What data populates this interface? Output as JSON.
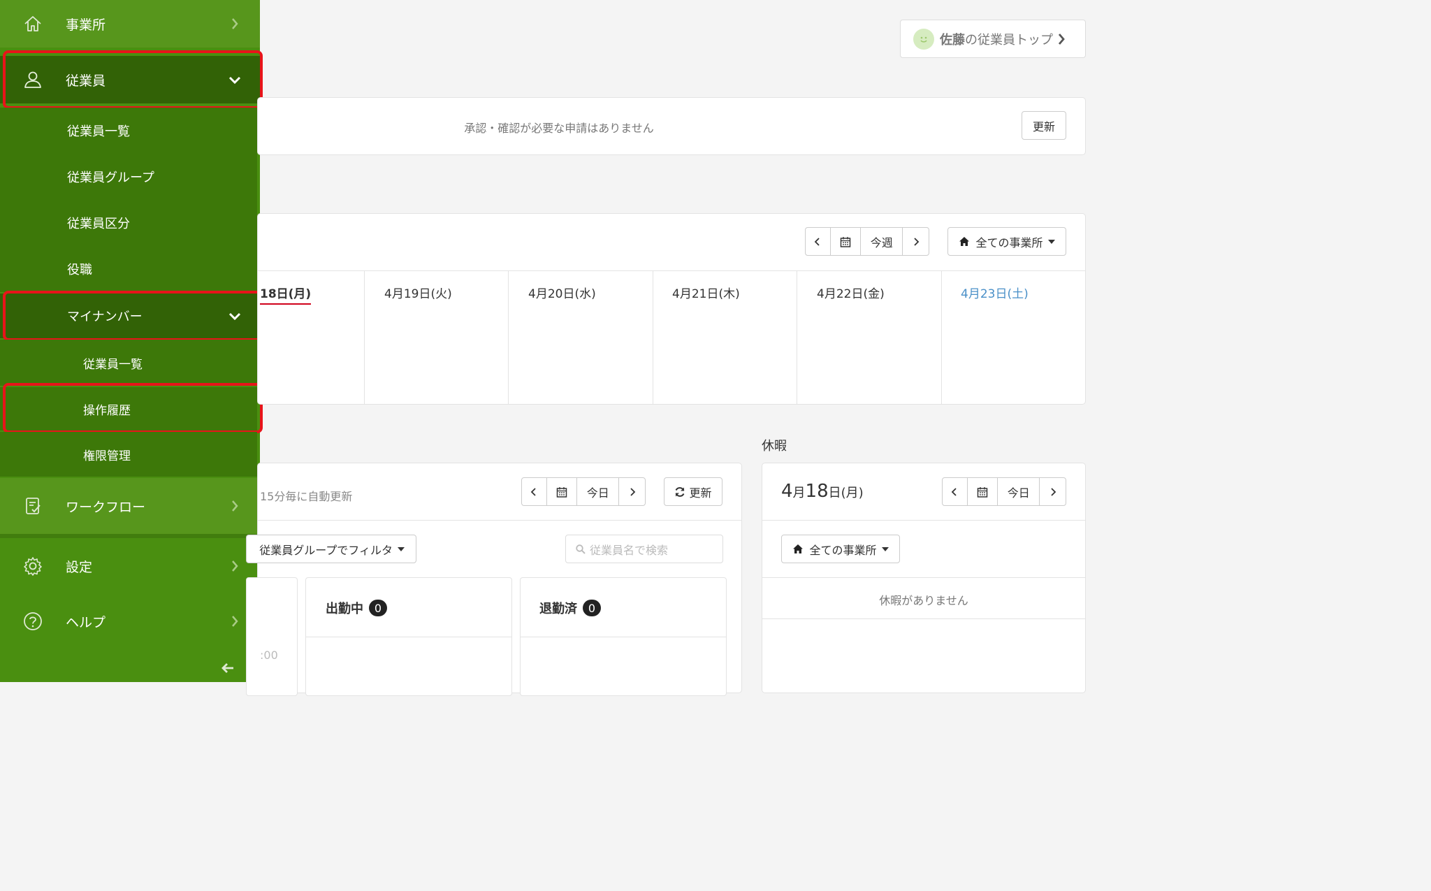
{
  "sidebar": {
    "items": {
      "office": "事業所",
      "employees": "従業員",
      "workflow": "ワークフロー",
      "settings": "設定",
      "help": "ヘルプ"
    },
    "employee_sub": [
      "従業員一覧",
      "従業員グループ",
      "従業員区分",
      "役職"
    ],
    "mynumber": "マイナンバー",
    "mynumber_sub": [
      "従業員一覧",
      "操作履歴",
      "権限管理"
    ]
  },
  "header": {
    "user_name": "佐藤",
    "user_suffix": "の従業員トップ"
  },
  "approvals": {
    "message": "承認・確認が必要な申請はありません",
    "refresh": "更新"
  },
  "week": {
    "this_week": "今週",
    "office_filter": "全ての事業所",
    "days": [
      "18日(月)",
      "4月19日(火)",
      "4月20日(水)",
      "4月21日(木)",
      "4月22日(金)",
      "4月23日(土)"
    ]
  },
  "attendance": {
    "auto_refresh": "15分毎に自動更新",
    "today": "今日",
    "refresh": "更新",
    "group_filter": "従業員グループでフィルタ",
    "search_placeholder": "従業員名で検索",
    "time_fragment": ":00",
    "working_label": "出勤中",
    "working_count": "0",
    "left_label": "退勤済",
    "left_count": "0"
  },
  "leave": {
    "section_title": "休暇",
    "date_month": "4",
    "date_month_unit": "月",
    "date_day": "18",
    "date_day_unit": "日(月)",
    "today": "今日",
    "office_filter": "全ての事業所",
    "empty_message": "休暇がありません"
  },
  "colors": {
    "sidebar_green": "#4a8f10",
    "sidebar_active": "#326206",
    "highlight_red": "#e8141a",
    "today_underline": "#d0021b",
    "saturday_blue": "#4a90c8"
  }
}
